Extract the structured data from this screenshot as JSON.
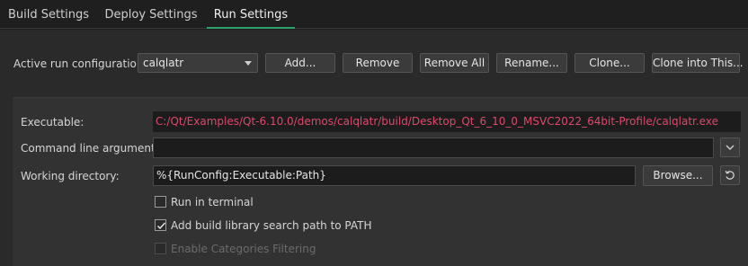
{
  "tabs": [
    {
      "label": "Build Settings",
      "active": false
    },
    {
      "label": "Deploy Settings",
      "active": false
    },
    {
      "label": "Run Settings",
      "active": true
    }
  ],
  "run_config": {
    "label": "Active run configuration:",
    "selected": "calqlatr",
    "buttons": {
      "add": "Add...",
      "remove": "Remove",
      "remove_all": "Remove All",
      "rename": "Rename...",
      "clone": "Clone...",
      "clone_into": "Clone into This..."
    }
  },
  "form": {
    "executable_label": "Executable:",
    "executable_value": "C:/Qt/Examples/Qt-6.10.0/demos/calqlatr/build/Desktop_Qt_6_10_0_MSVC2022_64bit-Profile/calqlatr.exe",
    "args_label": "Command line arguments:",
    "args_value": "",
    "workdir_label": "Working directory:",
    "workdir_value": "%{RunConfig:Executable:Path}",
    "browse_label": "Browse..."
  },
  "options": {
    "run_in_terminal": {
      "label": "Run in terminal",
      "checked": false
    },
    "add_build_lib": {
      "label": "Add build library search path to PATH",
      "checked": true
    },
    "enable_categories": {
      "label": "Enable Categories Filtering",
      "checked": false,
      "disabled": true
    }
  },
  "colors": {
    "accent": "#2fa36b",
    "executable_text": "#e0486b"
  },
  "icons": {
    "args_expand": "chevron-down-icon",
    "workdir_reset": "reset-icon"
  }
}
